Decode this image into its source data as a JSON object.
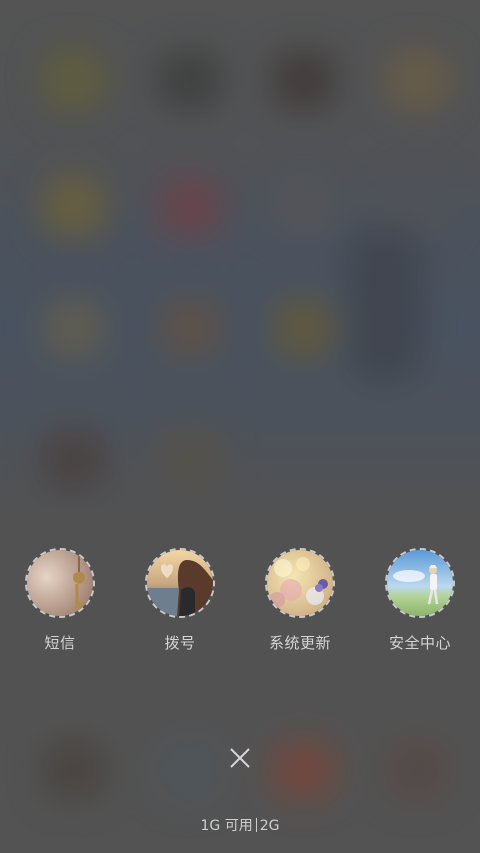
{
  "shortcuts": [
    {
      "label": "短信",
      "icon": "key-photo-icon"
    },
    {
      "label": "拨号",
      "icon": "heart-hands-photo-icon"
    },
    {
      "label": "系统更新",
      "icon": "bokeh-flowers-photo-icon"
    },
    {
      "label": "安全中心",
      "icon": "person-field-photo-icon"
    }
  ],
  "close": {
    "icon": "close-icon"
  },
  "memory": {
    "available": "1G 可用",
    "total": "2G"
  },
  "colors": {
    "label_text": "#d4d4d4",
    "dashed_ring": "#c9c9c9",
    "backdrop": "#5a5a5a"
  }
}
